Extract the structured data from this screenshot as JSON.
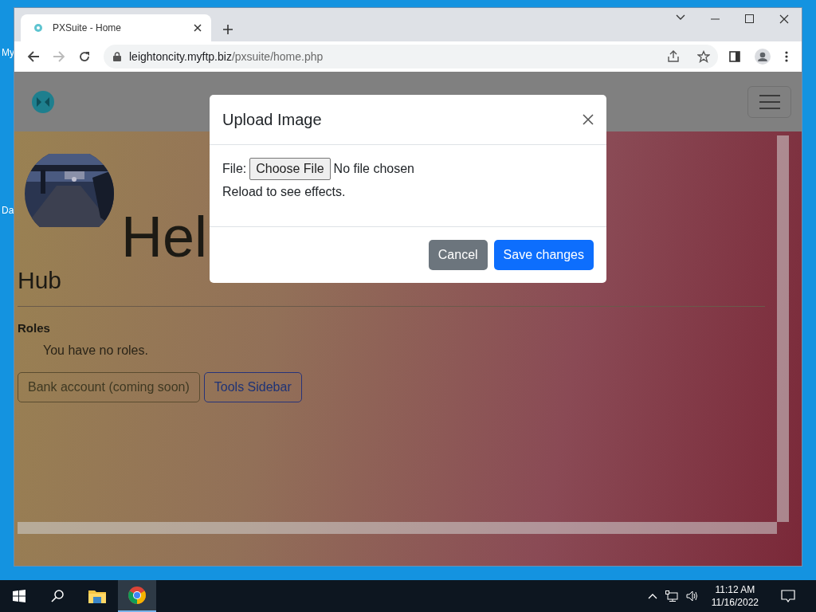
{
  "desktop": {
    "icon_labels": [
      "My",
      "Da"
    ]
  },
  "browser": {
    "tabs": [
      {
        "title": "PXSuite - Home",
        "selected": true
      }
    ],
    "address": {
      "host": "leightoncity.myftp.biz",
      "path": "/pxsuite/home.php"
    }
  },
  "page": {
    "heading": "Hel",
    "subheading": "Hub",
    "roles_label": "Roles",
    "roles_text": "You have no roles.",
    "buttons": [
      {
        "label": "Bank account (coming soon)",
        "disabled": true
      },
      {
        "label": "Tools Sidebar",
        "disabled": false
      }
    ]
  },
  "modal": {
    "title": "Upload Image",
    "file_label": "File:",
    "file_button": "Choose File",
    "file_status": "No file chosen",
    "note": "Reload to see effects.",
    "buttons": [
      {
        "label": "Cancel",
        "kind": "secondary"
      },
      {
        "label": "Save changes",
        "kind": "primary"
      }
    ]
  },
  "taskbar": {
    "apps": [
      {
        "kind": "explorer",
        "selected": false
      },
      {
        "kind": "chrome",
        "selected": true
      }
    ],
    "time": "11:12 AM",
    "date": "11/16/2022"
  }
}
